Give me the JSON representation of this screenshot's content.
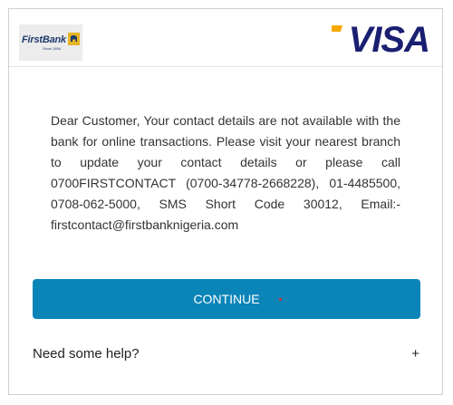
{
  "header": {
    "bank_logo_text": "FirstBank",
    "bank_logo_since": "Since 1894",
    "card_brand": "VISA"
  },
  "message": {
    "text": "Dear Customer, Your contact details are not available with the bank for online transactions. Please visit your nearest branch to update your contact details or please call 0700FIRSTCONTACT (0700-34778-2668228), 01-4485500, 0708-062-5000, SMS Short Code 30012, Email:- firstcontact@firstbanknigeria.com"
  },
  "actions": {
    "continue_label": "CONTINUE"
  },
  "help": {
    "label": "Need some help?",
    "expand_icon": "+"
  },
  "colors": {
    "primary_button": "#0b84b8",
    "visa_blue": "#1a1f71",
    "visa_gold": "#f7a800",
    "firstbank_blue": "#1f3a6d",
    "firstbank_gold": "#e6b325"
  }
}
